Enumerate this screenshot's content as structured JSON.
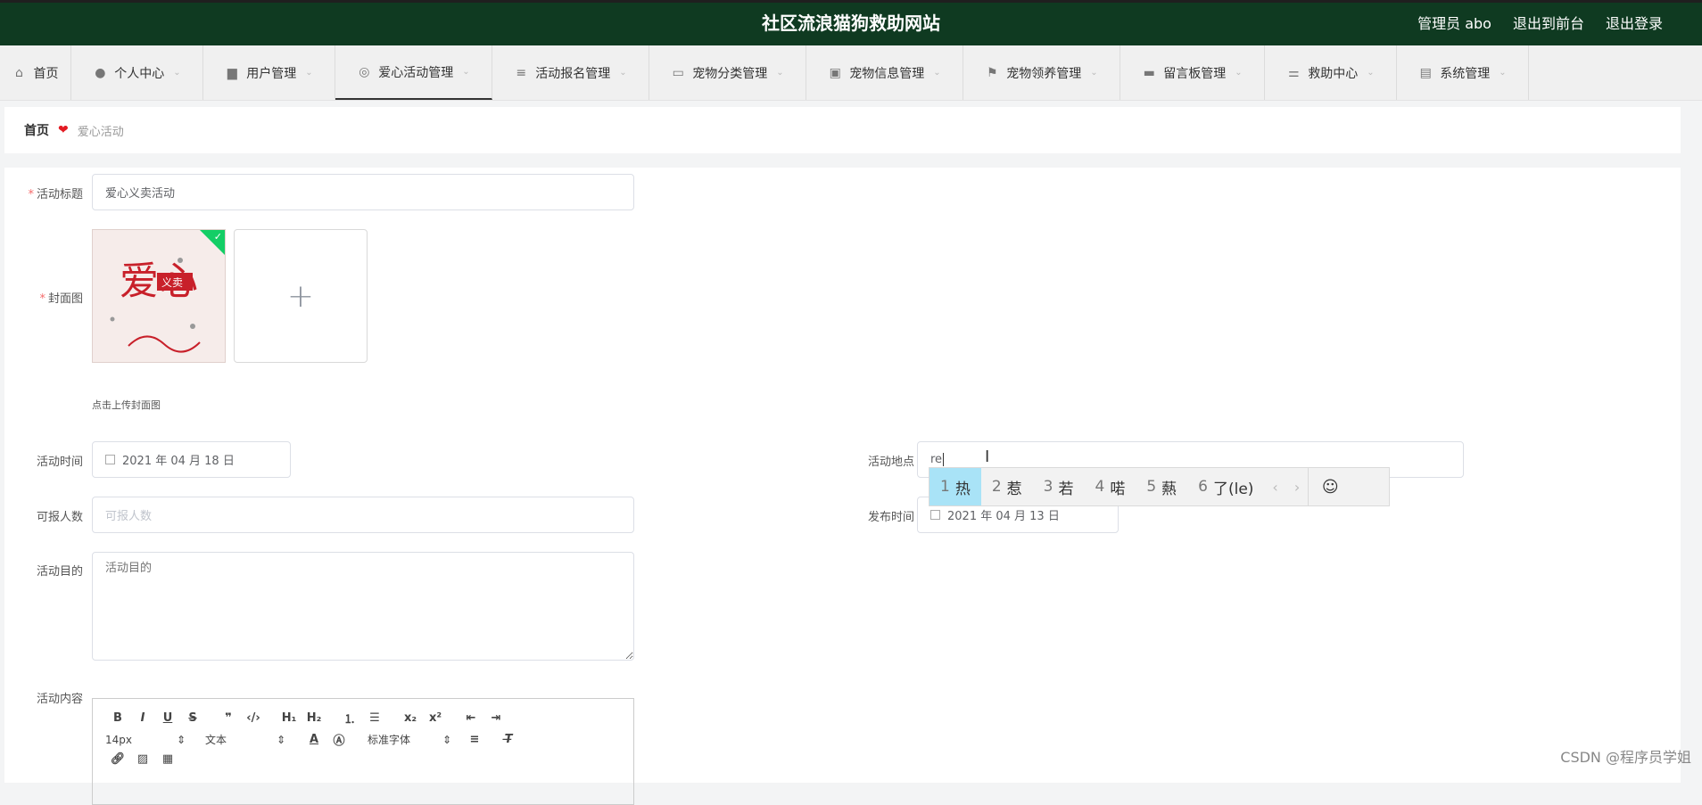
{
  "header": {
    "title": "社区流浪猫狗救助网站",
    "admin_label": "管理员 abo",
    "back_front": "退出到前台",
    "logout": "退出登录"
  },
  "nav": {
    "items": [
      {
        "label": "首页",
        "icon": "home-icon"
      },
      {
        "label": "个人中心",
        "icon": "user-icon"
      },
      {
        "label": "用户管理",
        "icon": "briefcase-icon"
      },
      {
        "label": "爱心活动管理",
        "icon": "target-icon"
      },
      {
        "label": "活动报名管理",
        "icon": "list-icon"
      },
      {
        "label": "宠物分类管理",
        "icon": "chat-icon"
      },
      {
        "label": "宠物信息管理",
        "icon": "clipboard-icon"
      },
      {
        "label": "宠物领养管理",
        "icon": "flag-icon"
      },
      {
        "label": "留言板管理",
        "icon": "monitor-icon"
      },
      {
        "label": "救助中心",
        "icon": "sliders-icon"
      },
      {
        "label": "系统管理",
        "icon": "document-icon"
      }
    ]
  },
  "breadcrumb": {
    "home": "首页",
    "current": "爱心活动"
  },
  "form": {
    "title_label": "活动标题",
    "title_value": "爱心义卖活动",
    "cover_label": "封面图",
    "cover_hint": "点击上传封面图",
    "cover_text_main": "爱心",
    "cover_text_tag": "义卖",
    "time_label": "活动时间",
    "time_value": "2021 年 04 月 18 日",
    "location_label": "活动地点",
    "location_value": "re",
    "quota_label": "可报人数",
    "quota_placeholder": "可报人数",
    "publish_label": "发布时间",
    "publish_value": "2021 年 04 月 13 日",
    "purpose_label": "活动目的",
    "purpose_placeholder": "活动目的",
    "content_label": "活动内容"
  },
  "editor": {
    "font_size": "14px",
    "text_type": "文本",
    "font_family": "标准字体"
  },
  "ime": {
    "candidates": [
      {
        "n": "1",
        "text": "热"
      },
      {
        "n": "2",
        "text": "惹"
      },
      {
        "n": "3",
        "text": "若"
      },
      {
        "n": "4",
        "text": "喏"
      },
      {
        "n": "5",
        "text": "爇"
      },
      {
        "n": "6",
        "text": "了(le)"
      }
    ],
    "emoji": "☺"
  },
  "watermark": "CSDN @程序员学姐",
  "colors": {
    "header_bg": "#0f3a21",
    "ime_highlight": "#a9e3f7",
    "heart": "#e31b23",
    "upload_check": "#13ce66"
  }
}
